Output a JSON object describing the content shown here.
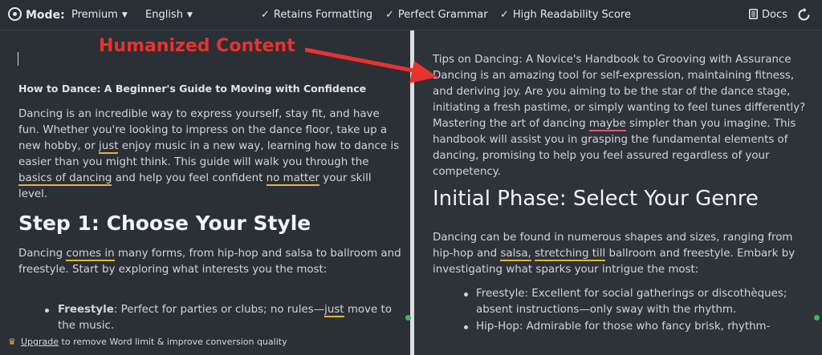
{
  "topbar": {
    "mode_label": "Mode:",
    "mode_value": "Premium",
    "language_value": "English",
    "features": [
      "Retains Formatting",
      "Perfect Grammar",
      "High Readability Score"
    ],
    "docs_label": "Docs"
  },
  "annotation": {
    "label": "Humanized Content",
    "color": "#e8322e"
  },
  "left": {
    "title": "How to Dance: A Beginner's Guide to Moving with Confidence",
    "p1": {
      "a": "Dancing is an incredible way to express yourself, stay fit, and have fun. Whether you're looking to impress on the dance floor, take up a new hobby, or ",
      "u1": "just",
      "b": " enjoy music in a new way, learning how to dance is easier than you might think. This guide will walk you through the ",
      "u2": "basics of dancing",
      "c": " and help you feel confident ",
      "u3": "no matter",
      "d": " your skill level."
    },
    "h2": "Step 1: Choose Your Style",
    "p2": {
      "a": "Dancing ",
      "u1": "comes in",
      "b": " many forms, from hip-hop and salsa to ballroom and freestyle. Start by exploring what interests you the most:"
    },
    "li1": {
      "strong": "Freestyle",
      "a": ": Perfect for parties or clubs; no rules—",
      "u1": "just",
      "b": " move to the music."
    }
  },
  "right": {
    "p1": {
      "a": "Tips on Dancing: A Novice's Handbook to Grooving with Assurance Dancing is an amazing tool for self-expression, maintaining fitness, and deriving joy. Are you aiming to be the star of the dance stage, initiating a fresh pastime, or simply wanting to feel tunes differently? Mastering the art of dancing ",
      "u1": "maybe",
      "b": " simpler than you imagine. This handbook will assist you in grasping the fundamental elements of dancing, promising to help you feel assured regardless of your competency."
    },
    "h2": "Initial Phase: Select Your Genre",
    "p2": {
      "a": "Dancing can be found in numerous shapes and sizes, ranging from hip-hop and ",
      "u1": "salsa,",
      "b": " ",
      "u2": "stretching till",
      "c": " ballroom and freestyle. Embark by investigating what sparks your intrigue the most:"
    },
    "li1": "Freestyle: Excellent for social gatherings or discothèques; absent instructions—only sway with the rhythm.",
    "li2": "Hip-Hop: Admirable for those who fancy brisk, rhythm-"
  },
  "bottombar": {
    "upgrade_link": "Upgrade",
    "message": " to remove Word limit & improve conversion quality"
  }
}
